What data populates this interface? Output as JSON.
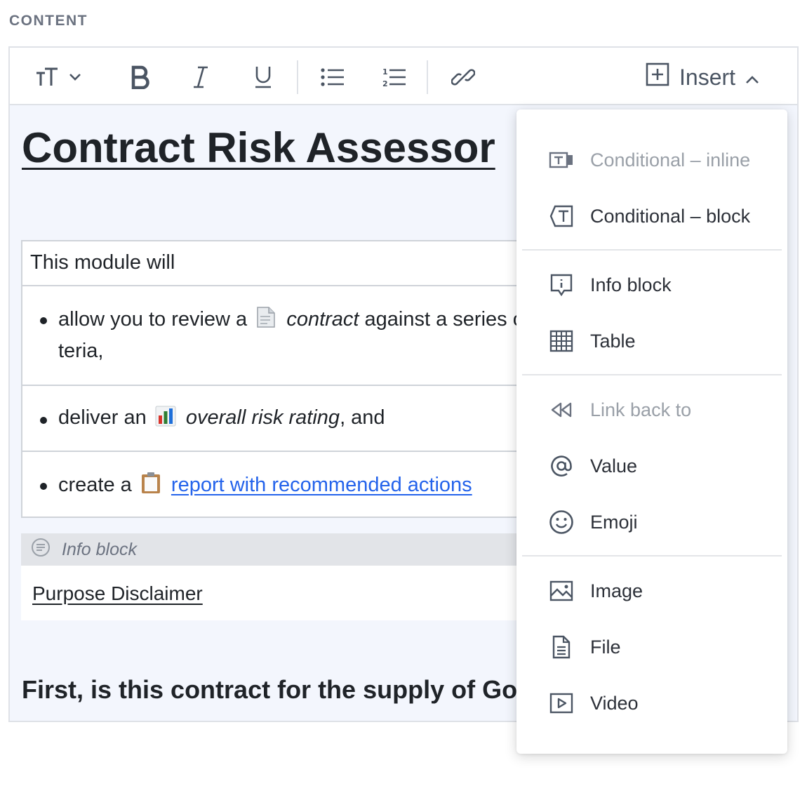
{
  "section_label": "CONTENT",
  "toolbar": {
    "text_style_icon": "text-size-icon",
    "bold_icon": "bold-icon",
    "italic_icon": "italic-icon",
    "underline_icon": "underline-icon",
    "bullet_list_icon": "bullet-list-icon",
    "numbered_list_icon": "numbered-list-icon",
    "link_icon": "link-icon",
    "insert_label": "Insert"
  },
  "document": {
    "title": "Contract Risk Assessor",
    "table": {
      "header": "This module will",
      "rows": [
        {
          "prefix": "allow you to review a",
          "emoji": "document-emoji",
          "italic": "contract",
          "suffix": " against a series of cri",
          "line2": "teria,"
        },
        {
          "prefix": "deliver an",
          "emoji": "bar-chart-emoji",
          "italic": "overall risk rating",
          "suffix": ", and"
        },
        {
          "prefix": "create a",
          "emoji": "clipboard-emoji",
          "link": "report with recommended actions"
        }
      ]
    },
    "info_block": {
      "label": "Info block",
      "content": "Purpose Disclaimer"
    },
    "question": "First, is this contract for the supply of Goods"
  },
  "insert_menu": {
    "groups": [
      [
        {
          "label": "Conditional – inline",
          "icon": "conditional-inline-icon",
          "disabled": true
        },
        {
          "label": "Conditional – block",
          "icon": "conditional-block-icon",
          "disabled": false
        }
      ],
      [
        {
          "label": "Info block",
          "icon": "info-block-icon",
          "disabled": false
        },
        {
          "label": "Table",
          "icon": "table-icon",
          "disabled": false
        }
      ],
      [
        {
          "label": "Link back to",
          "icon": "rewind-icon",
          "disabled": true
        },
        {
          "label": "Value",
          "icon": "at-sign-icon",
          "disabled": false
        },
        {
          "label": "Emoji",
          "icon": "smiley-icon",
          "disabled": false
        }
      ],
      [
        {
          "label": "Image",
          "icon": "image-icon",
          "disabled": false
        },
        {
          "label": "File",
          "icon": "file-icon",
          "disabled": false
        },
        {
          "label": "Video",
          "icon": "video-icon",
          "disabled": false
        }
      ]
    ]
  }
}
